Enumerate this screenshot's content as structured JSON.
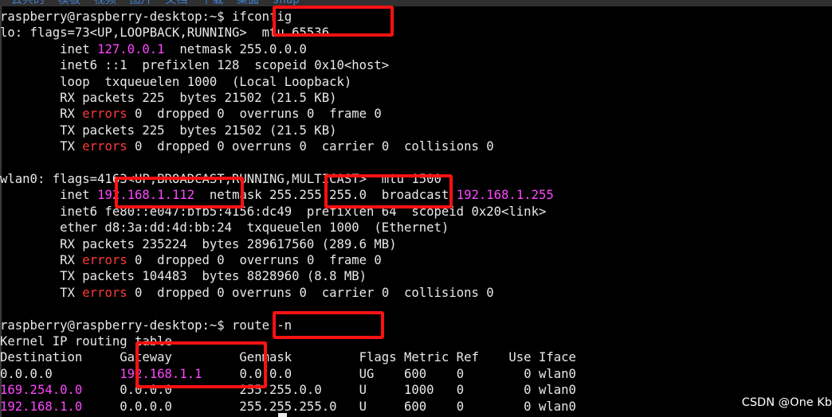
{
  "topbar": {
    "text": "云共的  模板  视频  图片  文档  下载  桌面  snap"
  },
  "lines": [
    {
      "parts": [
        {
          "t": "raspberry@raspberry-desktop:~$ ifconfig"
        }
      ]
    },
    {
      "parts": [
        {
          "t": "lo: flags=73<UP,LOOPBACK,RUNNING>  mtu 65536"
        }
      ]
    },
    {
      "parts": [
        {
          "t": "        inet "
        },
        {
          "t": "127.0.0.1",
          "c": "pink"
        },
        {
          "t": "  netmask 255.0.0.0"
        }
      ]
    },
    {
      "parts": [
        {
          "t": "        inet6 ::1  prefixlen 128  scopeid 0x10<host>"
        }
      ]
    },
    {
      "parts": [
        {
          "t": "        loop  txqueuelen 1000  (Local Loopback)"
        }
      ]
    },
    {
      "parts": [
        {
          "t": "        RX packets 225  bytes 21502 (21.5 KB)"
        }
      ]
    },
    {
      "parts": [
        {
          "t": "        RX "
        },
        {
          "t": "errors",
          "c": "red"
        },
        {
          "t": " 0  dropped 0  overruns 0  frame 0"
        }
      ]
    },
    {
      "parts": [
        {
          "t": "        TX packets 225  bytes 21502 (21.5 KB)"
        }
      ]
    },
    {
      "parts": [
        {
          "t": "        TX "
        },
        {
          "t": "errors",
          "c": "red"
        },
        {
          "t": " 0  dropped 0 overruns 0  carrier 0  collisions 0"
        }
      ]
    },
    {
      "parts": [
        {
          "t": ""
        }
      ]
    },
    {
      "parts": [
        {
          "t": "wlan0: flags=4163<UP,BROADCAST,RUNNING,MULTICAST>  mtu 1500"
        }
      ]
    },
    {
      "parts": [
        {
          "t": "        inet "
        },
        {
          "t": "192.168.1.112",
          "c": "pink"
        },
        {
          "t": "  netmask 255.255.255.0  broadcast "
        },
        {
          "t": "192.168.1.255",
          "c": "pink"
        }
      ]
    },
    {
      "parts": [
        {
          "t": "        inet6 fe80::e047:bfb5:4156:dc49  prefixlen 64  scopeid 0x20<link>"
        }
      ]
    },
    {
      "parts": [
        {
          "t": "        ether d8:3a:dd:4d:bb:24  txqueuelen 1000  (Ethernet)"
        }
      ]
    },
    {
      "parts": [
        {
          "t": "        RX packets 235224  bytes 289617560 (289.6 MB)"
        }
      ]
    },
    {
      "parts": [
        {
          "t": "        RX "
        },
        {
          "t": "errors",
          "c": "red"
        },
        {
          "t": " 0  dropped 0  overruns 0  frame 0"
        }
      ]
    },
    {
      "parts": [
        {
          "t": "        TX packets 104483  bytes 8828960 (8.8 MB)"
        }
      ]
    },
    {
      "parts": [
        {
          "t": "        TX "
        },
        {
          "t": "errors",
          "c": "red"
        },
        {
          "t": " 0  dropped 0 overruns 0  carrier 0  collisions 0"
        }
      ]
    },
    {
      "parts": [
        {
          "t": ""
        }
      ]
    },
    {
      "parts": [
        {
          "t": "raspberry@raspberry-desktop:~$ route -n"
        }
      ]
    },
    {
      "parts": [
        {
          "t": "Kernel IP routing table"
        }
      ]
    },
    {
      "parts": [
        {
          "t": "Destination     Gateway         Genmask         Flags Metric Ref    Use Iface"
        }
      ]
    },
    {
      "parts": [
        {
          "t": "0.0.0.0         "
        },
        {
          "t": "192.168.1.1",
          "c": "pink"
        },
        {
          "t": "     0.0.0.0         UG    600    0        0 wlan0"
        }
      ]
    },
    {
      "parts": [
        {
          "t": "169.254.0.0",
          "c": "pink"
        },
        {
          "t": "     0.0.0.0         255.255.0.0     U     1000   0        0 wlan0"
        }
      ]
    },
    {
      "parts": [
        {
          "t": "192.168.1.0",
          "c": "pink"
        },
        {
          "t": "     0.0.0.0         255.255.255.0   U     600    0        0 wlan0"
        }
      ]
    }
  ],
  "watermark": "CSDN @One Kb",
  "colors": {
    "background": "#000000",
    "text": "#e9e9e9",
    "ip": "#ff47ff",
    "errors": "#ff3a3a",
    "highlight": "#ff1111"
  }
}
